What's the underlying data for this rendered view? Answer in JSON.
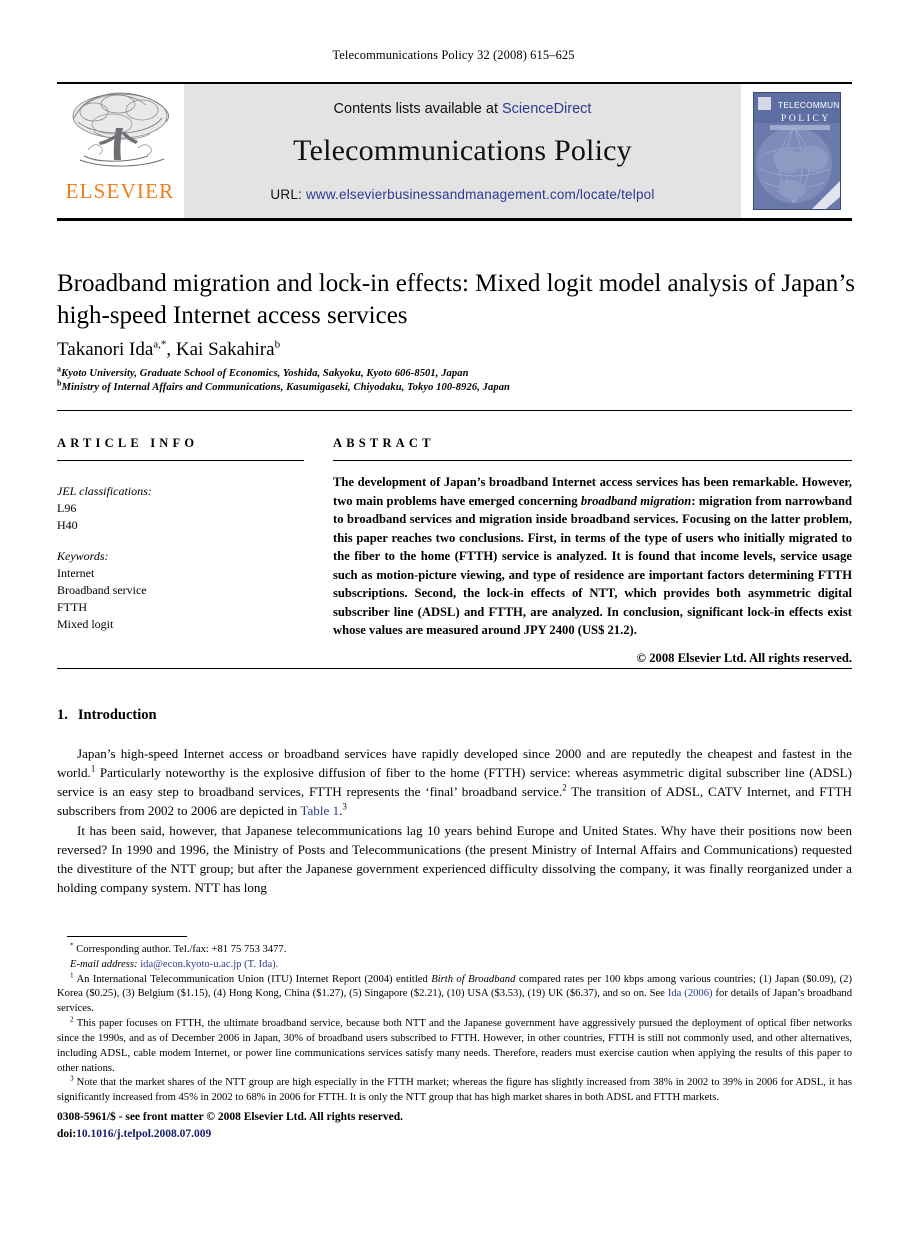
{
  "running_head": "Telecommunications Policy 32 (2008) 615–625",
  "masthead": {
    "publisher_name": "ELSEVIER",
    "contents_prefix": "Contents lists available at ",
    "contents_link": "ScienceDirect",
    "journal_name": "Telecommunications Policy",
    "url_prefix": "URL: ",
    "url_link": "www.elsevierbusinessandmanagement.com/locate/telpol",
    "cover_title_line1": "TELECOMMUNICATIONS",
    "cover_title_line2": "P O L I C Y",
    "colors": {
      "elsevier_orange": "#ef7d1a",
      "link_blue": "#2e3a91",
      "masthead_grey": "#e3e3e3",
      "cover_blue": "#5b6ea3"
    }
  },
  "article": {
    "title": "Broadband migration and lock-in effects: Mixed logit model analysis of Japan’s high-speed Internet access services",
    "authors": "Takanori Ida",
    "author_sup_1": "a,*",
    "author_2": ", Kai Sakahira",
    "author_sup_2": "b",
    "affiliation_a_sup": "a",
    "affiliation_a": "Kyoto University, Graduate School of Economics, Yoshida, Sakyoku, Kyoto 606-8501, Japan",
    "affiliation_b_sup": "b",
    "affiliation_b": "Ministry of Internal Affairs and Communications, Kasumigaseki, Chiyodaku, Tokyo 100-8926, Japan"
  },
  "article_info": {
    "heading": "ARTICLE INFO",
    "jel_label": "JEL classifications:",
    "jel_codes": [
      "L96",
      "H40"
    ],
    "keywords_label": "Keywords:",
    "keywords": [
      "Internet",
      "Broadband service",
      "FTTH",
      "Mixed logit"
    ]
  },
  "abstract": {
    "heading": "ABSTRACT",
    "text_part1": "The development of Japan’s broadband Internet access services has been remarkable. However, two main problems have emerged concerning ",
    "emphasis": "broadband migration",
    "text_part2": ": migration from narrowband to broadband services and migration inside broadband services. Focusing on the latter problem, this paper reaches two conclusions. First, in terms of the type of users who initially migrated to the fiber to the home (FTTH) service is analyzed. It is found that income levels, service usage such as motion-picture viewing, and type of residence are important factors determining FTTH subscriptions. Second, the lock-in effects of NTT, which provides both asymmetric digital subscriber line (ADSL) and FTTH, are analyzed. In conclusion, significant lock-in effects exist whose values are measured around JPY 2400 (US$ 21.2).",
    "copyright": "© 2008 Elsevier Ltd. All rights reserved."
  },
  "introduction": {
    "number": "1.",
    "heading": "Introduction",
    "para1_a": "Japan’s high-speed Internet access or broadband services have rapidly developed since 2000 and are reputedly the cheapest and fastest in the world.",
    "para1_sup1": "1",
    "para1_b": " Particularly noteworthy is the explosive diffusion of fiber to the home (FTTH) service: whereas asymmetric digital subscriber line (ADSL) service is an easy step to broadband services, FTTH represents the ‘final’ broadband service.",
    "para1_sup2": "2",
    "para1_c": " The transition of ADSL, CATV Internet, and FTTH subscribers from 2002 to 2006 are depicted in ",
    "para1_xref": "Table 1",
    "para1_d": ".",
    "para1_sup3": "3",
    "para2": "It has been said, however, that Japanese telecommunications lag 10 years behind Europe and United States. Why have their positions now been reversed? In 1990 and 1996, the Ministry of Posts and Telecommunications (the present Ministry of Internal Affairs and Communications) requested the divestiture of the NTT group; but after the Japanese government experienced difficulty dissolving the company, it was finally reorganized under a holding company system. NTT has long"
  },
  "footnotes": {
    "corresponding_marker": "*",
    "corresponding": " Corresponding author. Tel./fax: +81 75 753 3477.",
    "email_label": "E-mail address:",
    "email": " ida@econ.kyoto-u.ac.jp (T. Ida).",
    "fn1_marker": "1",
    "fn1_a": " An International Telecommunication Union (ITU) Internet Report (2004) entitled ",
    "fn1_em": "Birth of Broadband",
    "fn1_b": " compared rates per 100 kbps among various countries; (1) Japan ($0.09), (2) Korea ($0.25), (3) Belgium ($1.15), (4) Hong Kong, China ($1.27), (5) Singapore ($2.21), (10) USA ($3.53), (19) UK ($6.37), and so on. See ",
    "fn1_xref": "Ida (2006)",
    "fn1_c": " for details of Japan’s broadband services.",
    "fn2_marker": "2",
    "fn2": " This paper focuses on FTTH, the ultimate broadband service, because both NTT and the Japanese government have aggressively pursued the deployment of optical fiber networks since the 1990s, and as of December 2006 in Japan, 30% of broadband users subscribed to FTTH. However, in other countries, FTTH is still not commonly used, and other alternatives, including ADSL, cable modem Internet, or power line communications services satisfy many needs. Therefore, readers must exercise caution when applying the results of this paper to other nations.",
    "fn3_marker": "3",
    "fn3": " Note that the market shares of the NTT group are high especially in the FTTH market; whereas the figure has slightly increased from 38% in 2002 to 39% in 2006 for ADSL, it has significantly increased from 45% in 2002 to 68% in 2006 for FTTH. It is only the NTT group that has high market shares in both ADSL and FTTH markets."
  },
  "imprint": {
    "issn_line": "0308-5961/$ - see front matter © 2008 Elsevier Ltd. All rights reserved.",
    "doi_prefix": "doi:",
    "doi": "10.1016/j.telpol.2008.07.009"
  }
}
